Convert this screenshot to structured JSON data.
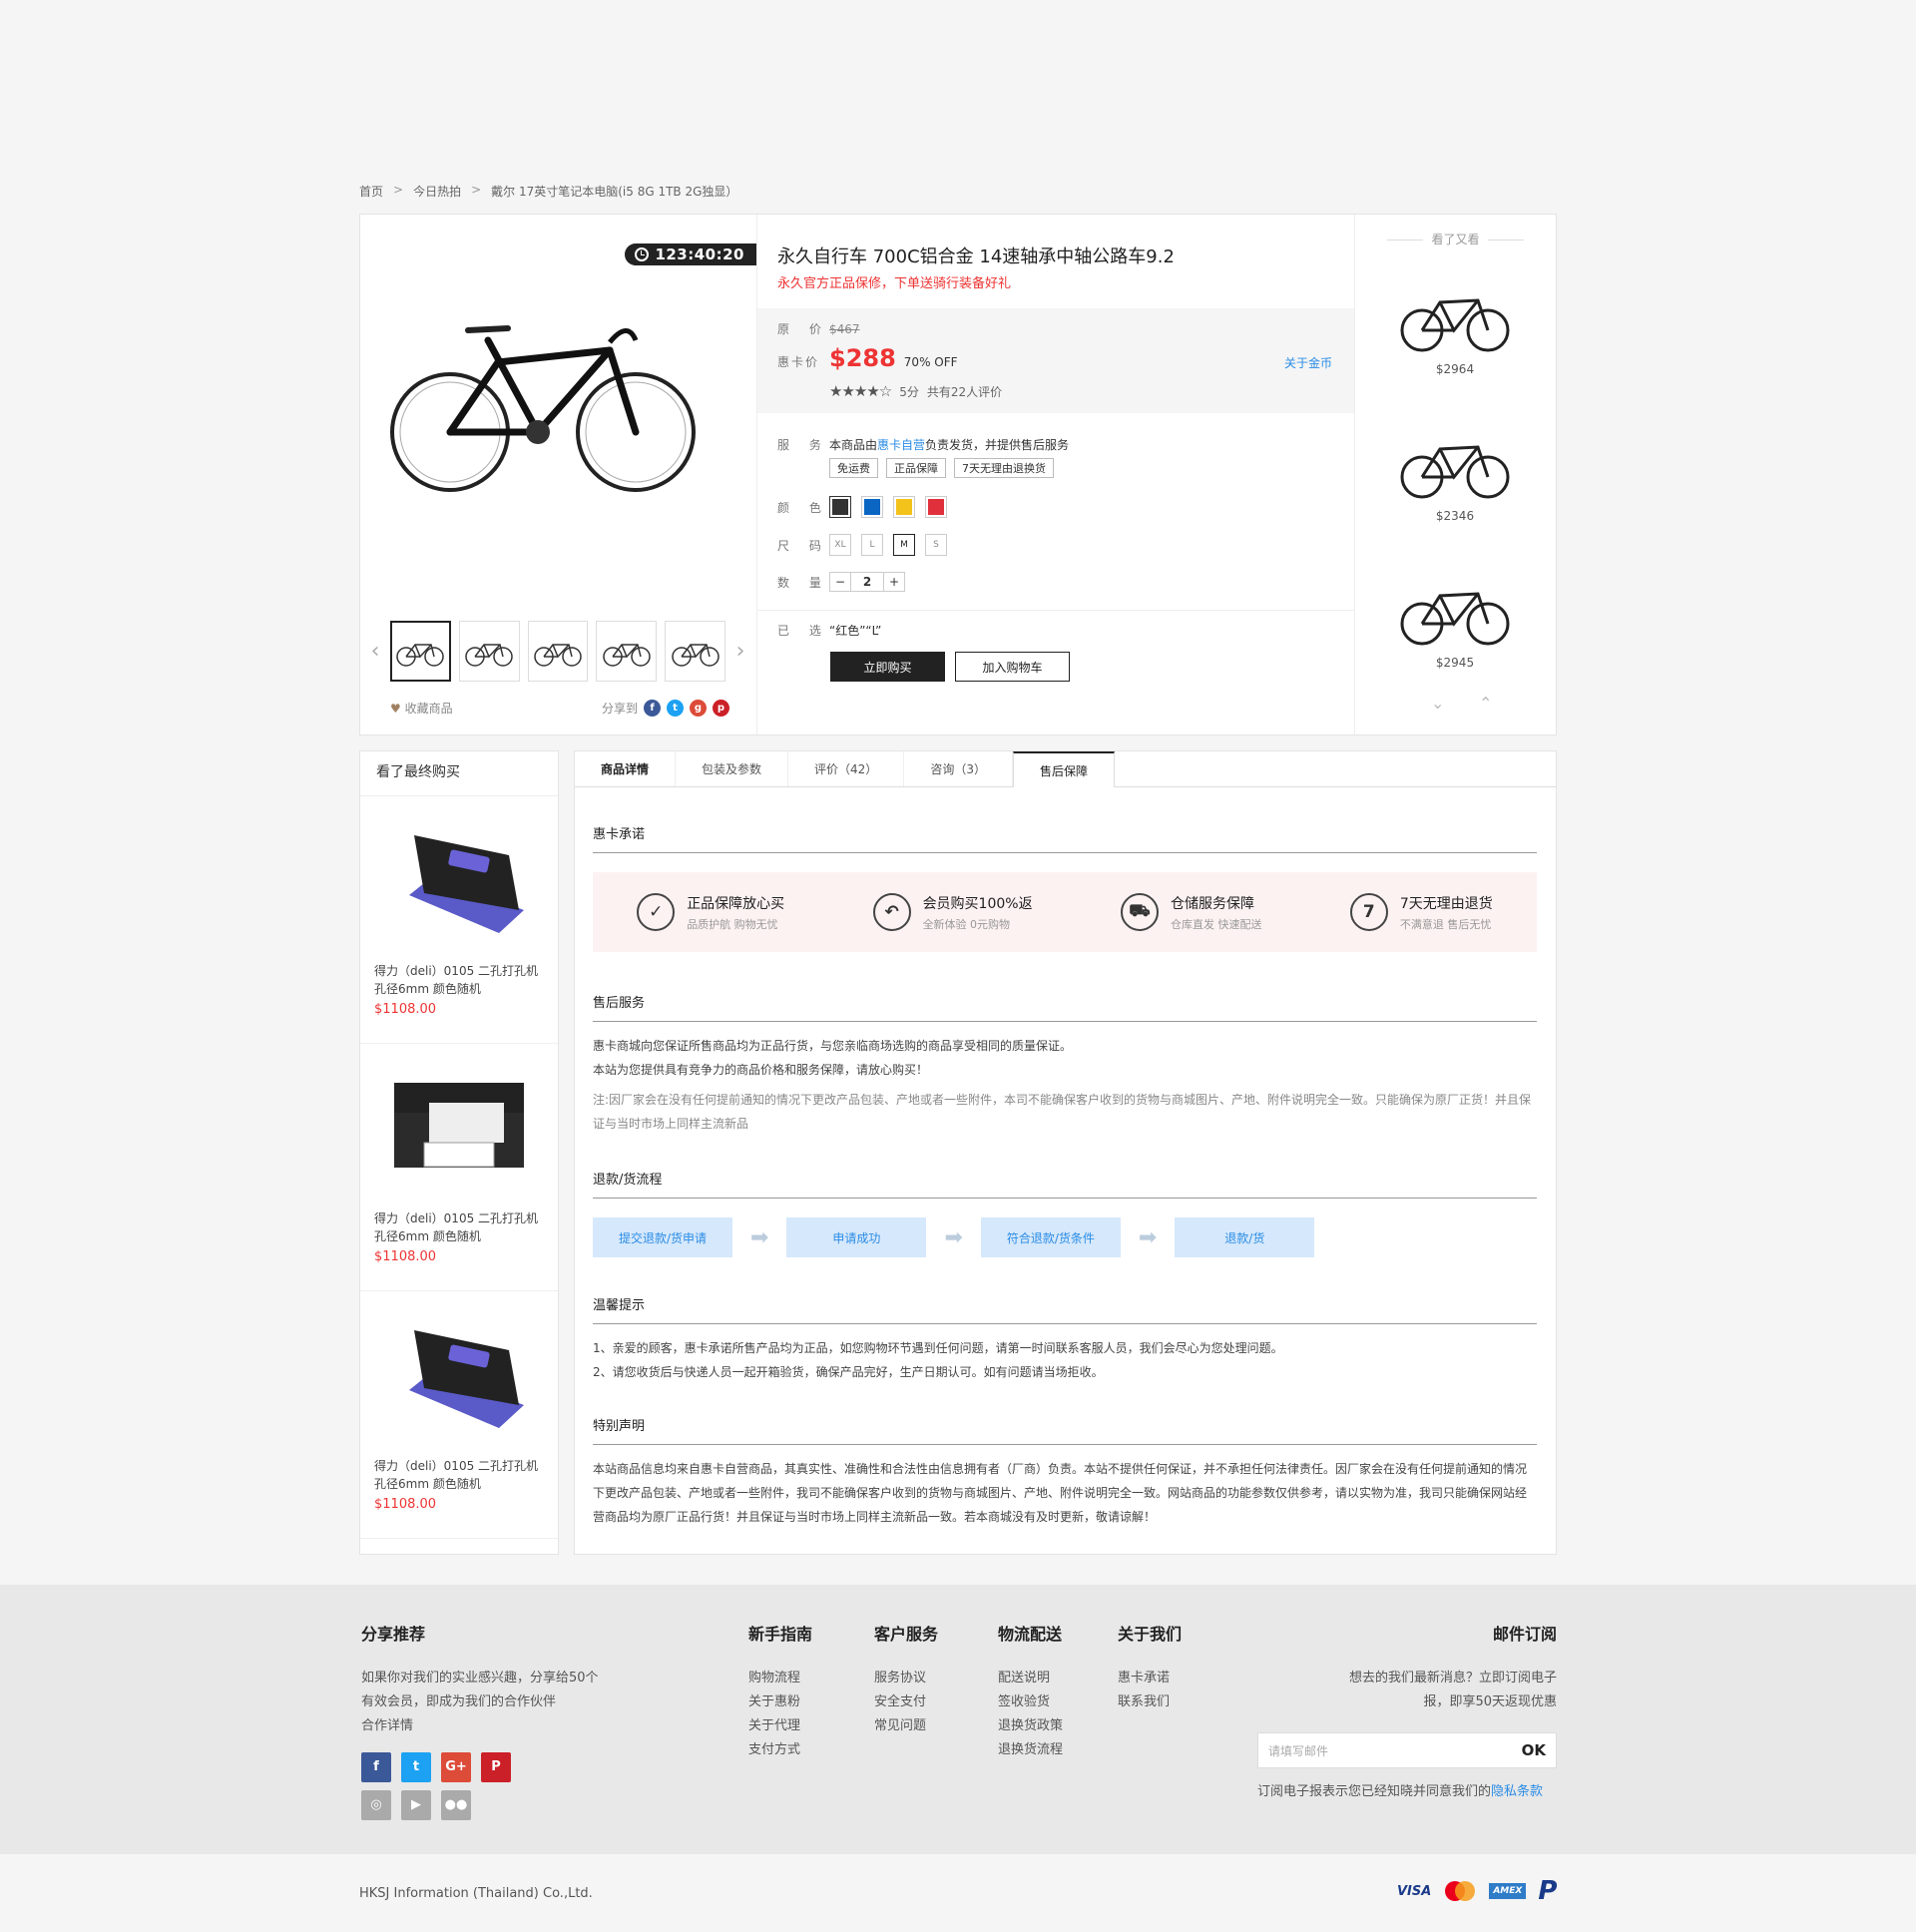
{
  "breadcrumb": [
    "首页",
    "今日热拍",
    "戴尔 17英寸笔记本电脑(i5 8G 1TB 2G独显）"
  ],
  "timer": "123:40:20",
  "product": {
    "title": "永久自行车 700C铝合金 14速轴承中轴公路车9.2",
    "subtitle": "永久官方正品保修，下单送骑行装备好礼",
    "orig_label": "原 价",
    "orig_price": "$467",
    "price_label": "惠卡价",
    "price": "$288",
    "discount": "70% OFF",
    "coupon": "关于金币",
    "rating": "5分",
    "reviews": "共有22人评价",
    "service_label": "服 务",
    "service_text_a": "本商品由",
    "service_link": "惠卡自营",
    "service_text_b": "负责发货，并提供售后服务",
    "tags": [
      "免运费",
      "正品保障",
      "7天无理由退换货"
    ],
    "color_label": "颜 色",
    "colors": [
      "#333333",
      "#0a66c2",
      "#f3c21b",
      "#e0303c"
    ],
    "size_label": "尺 码",
    "sizes": [
      "XL",
      "L",
      "M",
      "S"
    ],
    "qty_label": "数 量",
    "qty": "2",
    "selected_label": "已 选",
    "selected": "“红色”“L”",
    "buy": "立即购买",
    "cart": "加入购物车",
    "fav": "收藏商品",
    "share": "分享到"
  },
  "side": {
    "title": "看了又看",
    "prices": [
      "$2964",
      "$2346",
      "$2945"
    ]
  },
  "rec": {
    "title": "看了最终购买",
    "items": [
      {
        "name": "得力（deli）0105 二孔打孔机孔径6mm 颜色随机",
        "price": "$1108.00"
      },
      {
        "name": "得力（deli）0105 二孔打孔机孔径6mm 颜色随机",
        "price": "$1108.00"
      },
      {
        "name": "得力（deli）0105 二孔打孔机孔径6mm 颜色随机",
        "price": "$1108.00"
      }
    ]
  },
  "tabs": [
    "商品详情",
    "包装及参数",
    "评价（42）",
    "咨询（3）",
    "售后保障"
  ],
  "promise": {
    "title": "惠卡承诺",
    "items": [
      {
        "icon": "✓",
        "t": "正品保障放心买",
        "s": "品质护航 购物无忧"
      },
      {
        "icon": "↶",
        "t": "会员购买100%返",
        "s": "全新体验 0元购物"
      },
      {
        "icon": "⛟",
        "t": "仓储服务保障",
        "s": "仓库直发 快速配送"
      },
      {
        "icon": "7",
        "t": "7天无理由退货",
        "s": "不满意退 售后无忧"
      }
    ]
  },
  "after": {
    "title": "售后服务",
    "l1": "惠卡商城向您保证所售商品均为正品行货，与您亲临商场选购的商品享受相同的质量保证。",
    "l2": "本站为您提供具有竞争力的商品价格和服务保障，请放心购买！",
    "note": "注:因厂家会在没有任何提前通知的情况下更改产品包装、产地或者一些附件，本司不能确保客户收到的货物与商城图片、产地、附件说明完全一致。只能确保为原厂正货！并且保证与当时市场上同样主流新品"
  },
  "flow": {
    "title": "退款/货流程",
    "steps": [
      "提交退款/货申请",
      "申请成功",
      "符合退款/货条件",
      "退款/货"
    ]
  },
  "tips": {
    "title": "温馨提示",
    "l1": "1、亲爱的顾客，惠卡承诺所售产品均为正品，如您购物环节遇到任何问题，请第一时间联系客服人员，我们会尽心为您处理问题。",
    "l2": "2、请您收货后与快递人员一起开箱验货，确保产品完好，生产日期认可。如有问题请当场拒收。"
  },
  "statement": {
    "title": "特别声明",
    "text": "本站商品信息均来自惠卡自营商品，其真实性、准确性和合法性由信息拥有者（厂商）负责。本站不提供任何保证，并不承担任何法律责任。因厂家会在没有任何提前通知的情况下更改产品包装、产地或者一些附件，我司不能确保客户收到的货物与商城图片、产地、附件说明完全一致。网站商品的功能参数仅供参考，请以实物为准，我司只能确保网站经营商品均为原厂正品行货！并且保证与当时市场上同样主流新品一致。若本商城没有及时更新，敬请谅解！"
  },
  "footer": {
    "share": {
      "title": "分享推荐",
      "l1": "如果你对我们的实业感兴趣，分享给50个",
      "l2": "有效会员，即成为我们的合作伙伴",
      "l3": "合作详情"
    },
    "cols": [
      {
        "title": "新手指南",
        "items": [
          "购物流程",
          "关于惠粉",
          "关于代理",
          "支付方式"
        ]
      },
      {
        "title": "客户服务",
        "items": [
          "服务协议",
          "安全支付",
          "常见问题"
        ]
      },
      {
        "title": "物流配送",
        "items": [
          "配送说明",
          "签收验货",
          "退换货政策",
          "退换货流程"
        ]
      },
      {
        "title": "关于我们",
        "items": [
          "惠卡承诺",
          "联系我们"
        ]
      }
    ],
    "mail": {
      "title": "邮件订阅",
      "l1": "想去的我们最新消息？立即订阅电子",
      "l2": "报，即享50天返现优惠",
      "placeholder": "请填写邮件",
      "ok": "OK",
      "agree": "订阅电子报表示您已经知晓并同意我们的",
      "privacy": "隐私条款"
    },
    "copyright": "HKSJ Information (Thailand) Co.,Ltd.",
    "pay": [
      "VISA",
      "AMEX",
      "P"
    ]
  }
}
